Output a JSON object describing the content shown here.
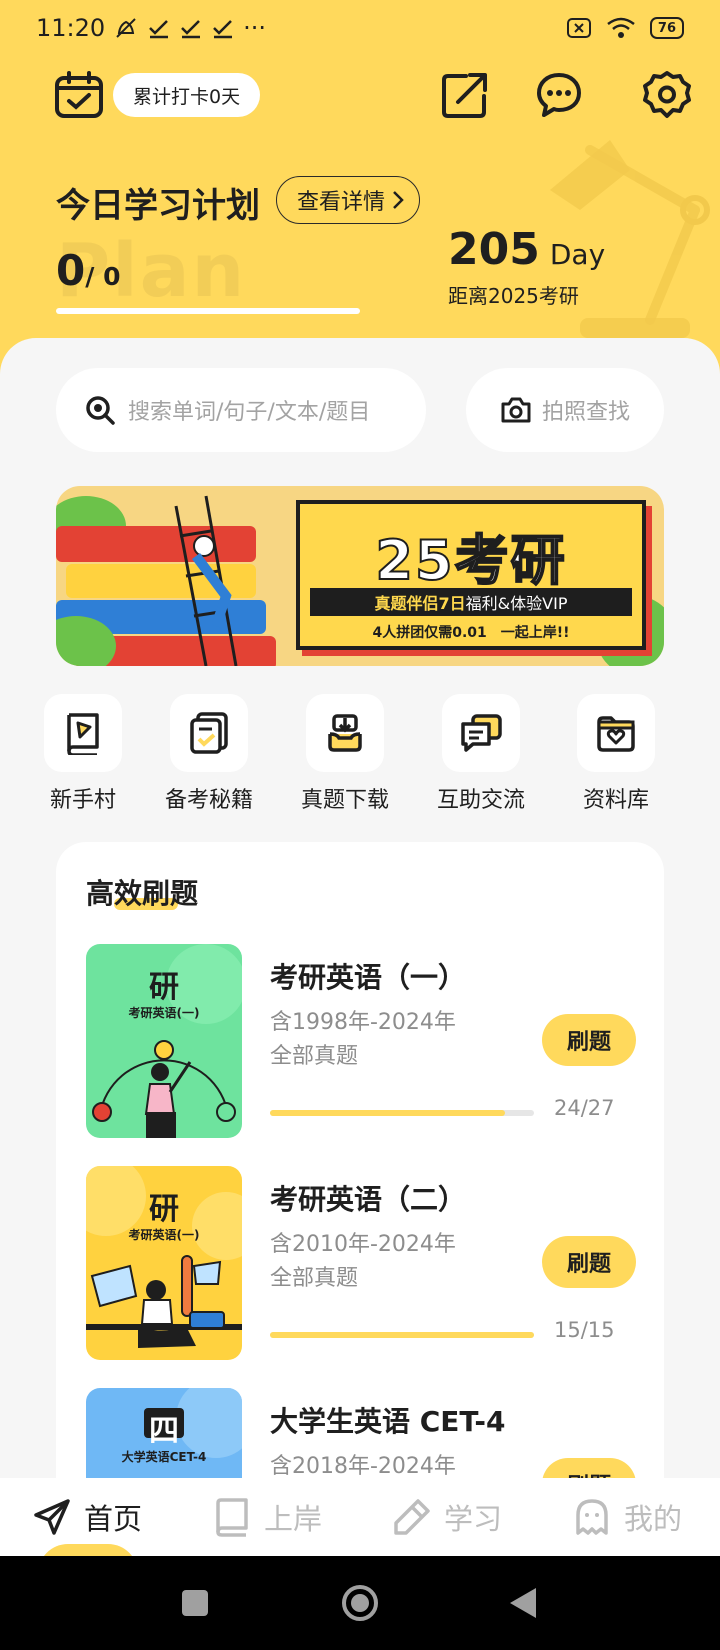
{
  "status_bar": {
    "time": "11:20",
    "dots": "···",
    "battery": "76"
  },
  "header": {
    "checkin_label": "累计打卡0天"
  },
  "plan": {
    "title": "今日学习计划",
    "detail_button": "查看详情",
    "watermark": "Plan",
    "done": "0",
    "total": "/ 0",
    "progress": 0
  },
  "countdown": {
    "days": "205",
    "unit": "Day",
    "caption": "距离2025考研"
  },
  "search": {
    "placeholder": "搜索单词/句子/文本/题目",
    "photo_label": "拍照查找"
  },
  "banner": {
    "title": "25考研",
    "strip_highlight": "真题伴侣7日",
    "strip_rest": "福利&体验VIP",
    "subtitle": "4人拼团仅需0.01　一起上岸!!"
  },
  "shortcuts": [
    {
      "label": "新手村",
      "icon": "book-flag-icon"
    },
    {
      "label": "备考秘籍",
      "icon": "checklist-icon"
    },
    {
      "label": "真题下载",
      "icon": "download-tray-icon"
    },
    {
      "label": "互助交流",
      "icon": "chat-bubbles-icon"
    },
    {
      "label": "资料库",
      "icon": "heart-folder-icon"
    }
  ],
  "practice": {
    "title": "高效刷题",
    "courses": [
      {
        "name": "考研英语（一）",
        "desc1": "含1998年-2024年",
        "desc2": "全部真题",
        "button": "刷题",
        "progress_text": "24/27",
        "progress": 0.889,
        "cover_char": "研",
        "cover_sub": "考研英语(一)",
        "cover_color": "#6ee39e"
      },
      {
        "name": "考研英语（二）",
        "desc1": "含2010年-2024年",
        "desc2": "全部真题",
        "button": "刷题",
        "progress_text": "15/15",
        "progress": 1.0,
        "cover_char": "研",
        "cover_sub": "考研英语(一)",
        "cover_color": "#ffd23f"
      },
      {
        "name": "大学生英语 CET-4",
        "desc1": "含2018年-2024年",
        "desc2": "",
        "button": "刷题",
        "progress_text": "",
        "progress": 0,
        "cover_char": "四",
        "cover_sub": "大学英语CET-4",
        "cover_color": "#6fb8f5"
      }
    ]
  },
  "tabs": [
    {
      "label": "首页",
      "active": true
    },
    {
      "label": "上岸",
      "active": false
    },
    {
      "label": "学习",
      "active": false
    },
    {
      "label": "我的",
      "active": false
    }
  ]
}
